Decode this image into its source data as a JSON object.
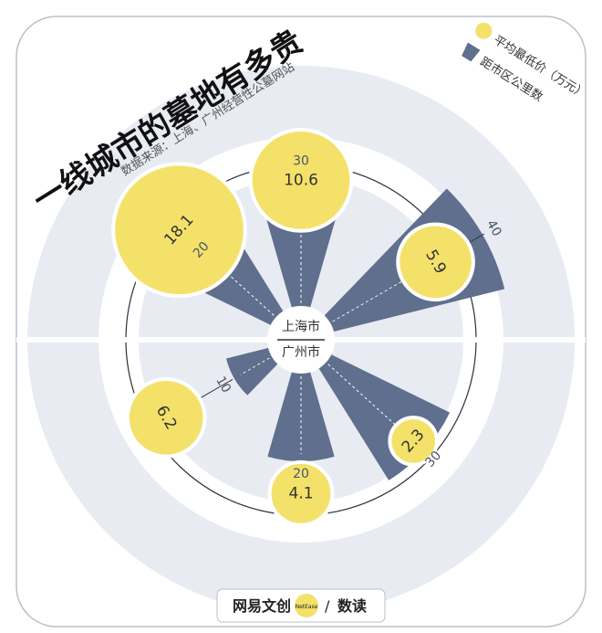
{
  "title": "一线城市的墓地有多贵",
  "source": "数据来源：上海、广州经营性公墓网站",
  "legend": {
    "price_label": "平均最低价（万元）",
    "distance_label": "距市区公里数",
    "price_color": "#f4e16a",
    "distance_color": "#5f6f8d"
  },
  "center": {
    "top_city": "上海市",
    "bottom_city": "广州市"
  },
  "brand": {
    "left": "网易文创",
    "badge": "NetEase",
    "separator": "/",
    "right": "数读"
  },
  "colors": {
    "panel": "#e8ebf2",
    "band": "#ffffff",
    "ring_line": "#2b2f3a",
    "yellow": "#f4e16a",
    "wedge": "#5f6f8d"
  },
  "chart_data": {
    "type": "polar-bar",
    "title": "一线城市的墓地有多贵",
    "series": [
      {
        "name": "平均最低价（万元）",
        "kind": "bubble"
      },
      {
        "name": "距市区公里数",
        "kind": "wedge"
      }
    ],
    "groups": [
      {
        "city": "上海市",
        "cemeteries": [
          {
            "distance_km": 20,
            "price_wan": 18.1,
            "distance_label": "20",
            "price_label": "18.1"
          },
          {
            "distance_km": 30,
            "price_wan": 10.6,
            "distance_label": "30",
            "price_label": "10.6"
          },
          {
            "distance_km": 40,
            "price_wan": 5.9,
            "distance_label": "40",
            "price_label": "5.9"
          }
        ]
      },
      {
        "city": "广州市",
        "cemeteries": [
          {
            "distance_km": 30,
            "price_wan": 2.3,
            "distance_label": "30",
            "price_label": "2.3"
          },
          {
            "distance_km": 20,
            "price_wan": 4.1,
            "distance_label": "20",
            "price_label": "4.1"
          },
          {
            "distance_km": 10,
            "price_wan": 6.2,
            "distance_label": "10",
            "price_label": "6.2"
          }
        ]
      }
    ]
  }
}
